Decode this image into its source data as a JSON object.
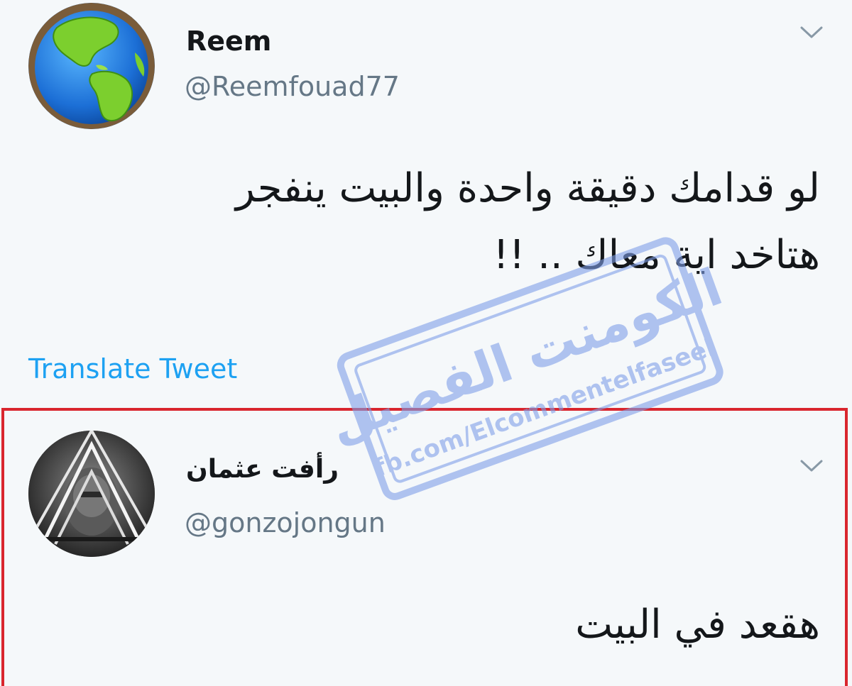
{
  "tweets": [
    {
      "avatar": "globe-avatar",
      "name": "Reem",
      "handle": "@Reemfouad77",
      "text_lines": [
        "لو قدامك دقيقة واحدة والبيت ينفجر",
        "هتاخد اية معاك .. !!"
      ],
      "translate_label": "Translate Tweet"
    },
    {
      "avatar": "dark-portrait-avatar",
      "name": "رأفت عثمان",
      "handle": "@gonzojongun",
      "text_lines": [
        "هقعد في البيت"
      ]
    }
  ],
  "watermark": {
    "arabic": "الكومنت الفصيل",
    "url": "fb.com/Elcommentelfaseel"
  },
  "colors": {
    "background": "#f5f8fa",
    "link": "#1da1f2",
    "highlight_border": "#d9262e",
    "stamp": "#7f9fe8"
  }
}
